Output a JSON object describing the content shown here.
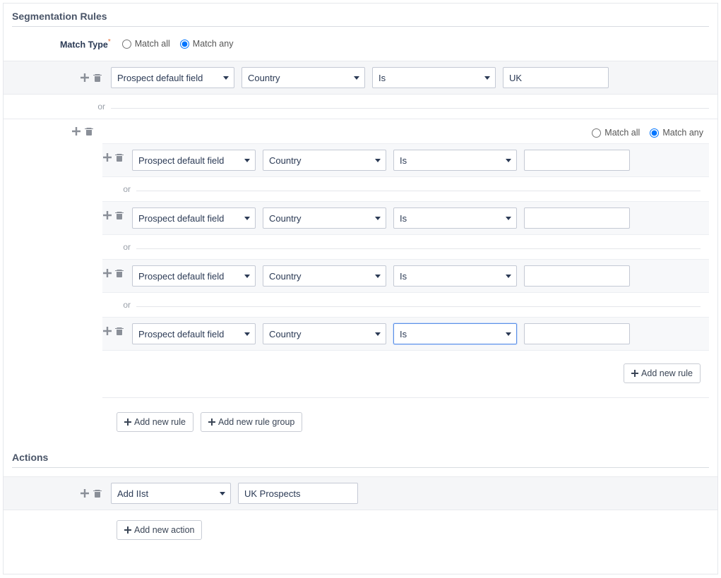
{
  "labels": {
    "section_rules": "Segmentation Rules",
    "section_actions": "Actions",
    "match_type": "Match Type",
    "match_all": "Match all",
    "match_any": "Match any",
    "or": "or",
    "add_new_rule": "Add new rule",
    "add_new_rule_group": "Add new rule group",
    "add_new_action": "Add new action"
  },
  "outer_match": "match_any",
  "rules": [
    {
      "field_type": "Prospect default field",
      "field": "Country",
      "op": "Is",
      "value": "UK"
    }
  ],
  "group": {
    "match": "match_any",
    "rules": [
      {
        "field_type": "Prospect default field",
        "field": "Country",
        "op": "Is",
        "value": "",
        "op_focused": false
      },
      {
        "field_type": "Prospect default field",
        "field": "Country",
        "op": "Is",
        "value": "",
        "op_focused": false
      },
      {
        "field_type": "Prospect default field",
        "field": "Country",
        "op": "Is",
        "value": "",
        "op_focused": false
      },
      {
        "field_type": "Prospect default field",
        "field": "Country",
        "op": "Is",
        "value": "",
        "op_focused": true
      }
    ]
  },
  "actions": [
    {
      "type": "Add IIst",
      "value": "UK Prospects"
    }
  ]
}
